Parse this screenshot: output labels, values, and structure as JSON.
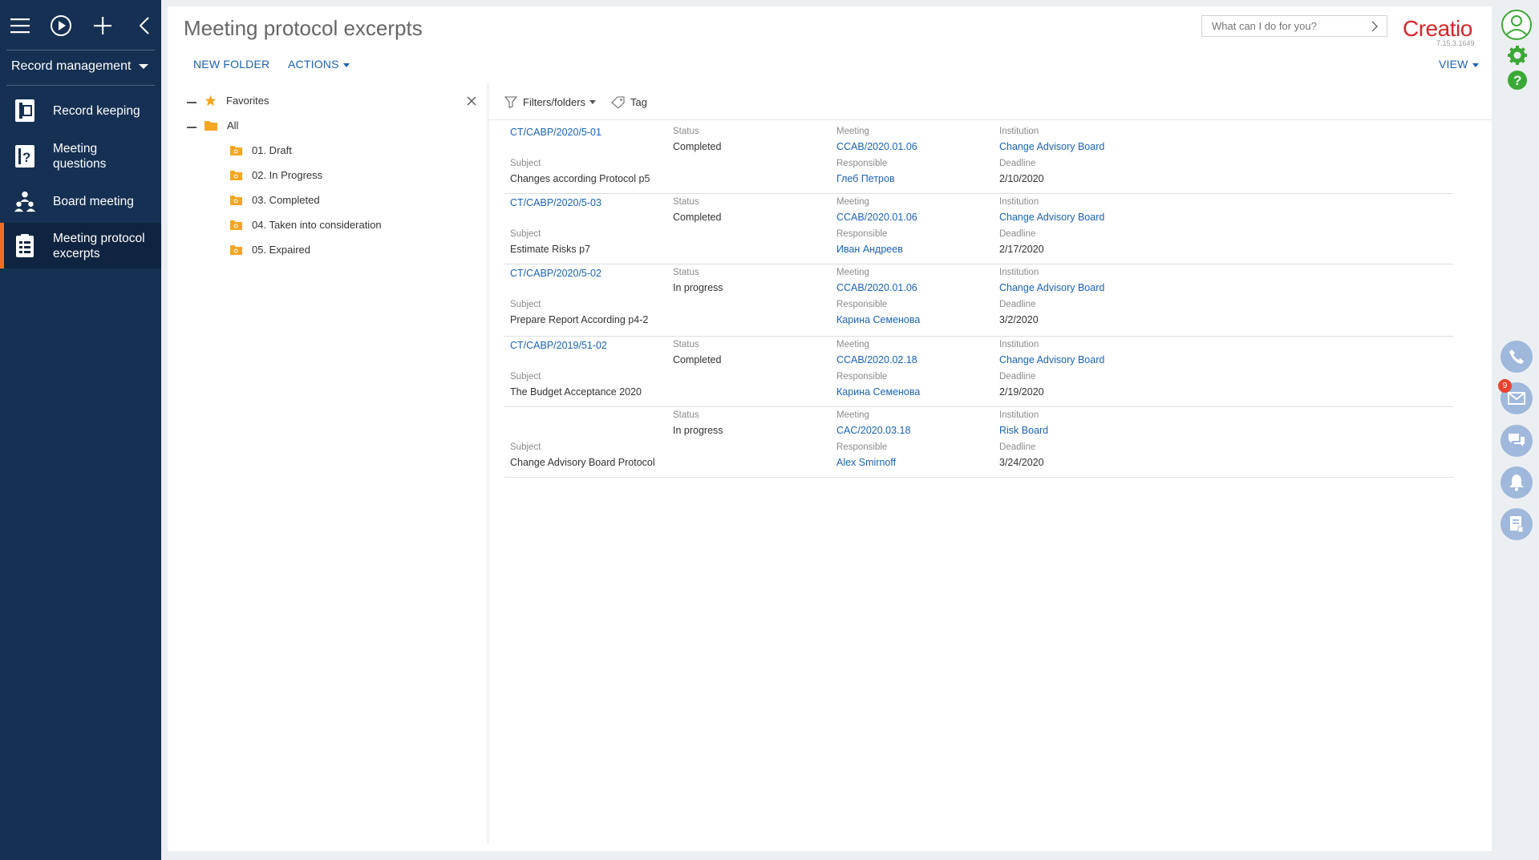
{
  "sidebar": {
    "section": "Record management",
    "items": [
      {
        "label": "Record keeping",
        "icon": "record-keeping-icon",
        "active": false
      },
      {
        "label": "Meeting questions",
        "icon": "meeting-questions-icon",
        "active": false
      },
      {
        "label": "Board meeting",
        "icon": "board-meeting-icon",
        "active": false
      },
      {
        "label": "Meeting protocol excerpts",
        "icon": "protocol-excerpts-icon",
        "active": true
      }
    ]
  },
  "header": {
    "title": "Meeting protocol excerpts",
    "new_folder": "NEW FOLDER",
    "actions": "ACTIONS",
    "view": "VIEW",
    "search_placeholder": "What can I do for you?",
    "logo": "Creatio",
    "version": "7.15.3.1649"
  },
  "folders": {
    "favorites": "Favorites",
    "all": "All",
    "children": [
      "01. Draft",
      "02. In Progress",
      "03. Completed",
      "04. Taken into consideration",
      "05. Expaired"
    ]
  },
  "toolbar": {
    "filters": "Filters/folders",
    "tag": "Tag"
  },
  "labels": {
    "status": "Status",
    "meeting": "Meeting",
    "institution": "Institution",
    "subject": "Subject",
    "responsible": "Responsible",
    "deadline": "Deadline"
  },
  "records": [
    {
      "number": "CT/CABP/2020/5-01",
      "status": "Completed",
      "meeting": "CCAB/2020.01.06",
      "institution": "Change Advisory Board",
      "subject": "Changes according Protocol p5",
      "responsible": "Глеб Петров",
      "deadline": "2/10/2020"
    },
    {
      "number": "CT/CABP/2020/5-03",
      "status": "Completed",
      "meeting": "CCAB/2020.01.06",
      "institution": "Change Advisory Board",
      "subject": "Estimate Risks p7",
      "responsible": "Иван Андреев",
      "deadline": "2/17/2020"
    },
    {
      "number": "CT/CABP/2020/5-02",
      "status": "In progress",
      "meeting": "CCAB/2020.01.06",
      "institution": "Change Advisory Board",
      "subject": "Prepare Report According p4-2",
      "responsible": "Карина Семенова",
      "deadline": "3/2/2020"
    },
    {
      "number": "CT/CABP/2019/51-02",
      "status": "Completed",
      "meeting": "CCAB/2020.02.18",
      "institution": "Change Advisory Board",
      "subject": "The Budget Acceptance 2020",
      "responsible": "Карина Семенова",
      "deadline": "2/19/2020"
    },
    {
      "number": "",
      "status": "In progress",
      "meeting": "CAC/2020.03.18",
      "institution": "Risk Board",
      "subject": "Change Advisory Board Protocol",
      "responsible": "Alex Smirnoff",
      "deadline": "3/24/2020"
    }
  ],
  "right_strip": {
    "email_badge": "9"
  },
  "colors": {
    "sidebar_bg": "#153052",
    "accent": "#f26d21",
    "link": "#1a63b5",
    "logo": "#d6262a",
    "green": "#3aa935"
  }
}
